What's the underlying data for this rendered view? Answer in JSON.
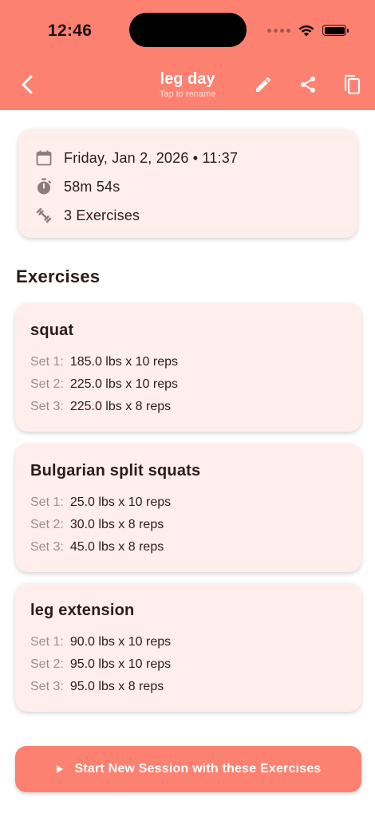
{
  "status": {
    "time": "12:46"
  },
  "header": {
    "title": "leg day",
    "subtitle": "Tap to rename",
    "icons": [
      "back-arrow-icon",
      "pencil-icon",
      "share-icon",
      "copy-icon"
    ]
  },
  "summary": {
    "date_time": "Friday, Jan 2, 2026 • 11:37",
    "duration": "58m 54s",
    "exercise_count": "3 Exercises",
    "icons": [
      "calendar-icon",
      "timer-icon",
      "dumbbell-icon"
    ]
  },
  "exercises_heading": "Exercises",
  "exercises": [
    {
      "name": "squat",
      "sets": [
        {
          "label": "Set 1:",
          "value": "185.0 lbs x 10 reps"
        },
        {
          "label": "Set 2:",
          "value": "225.0 lbs x 10 reps"
        },
        {
          "label": "Set 3:",
          "value": "225.0 lbs x 8 reps"
        }
      ]
    },
    {
      "name": "Bulgarian split squats",
      "sets": [
        {
          "label": "Set 1:",
          "value": "25.0 lbs x 10 reps"
        },
        {
          "label": "Set 2:",
          "value": "30.0 lbs x 8 reps"
        },
        {
          "label": "Set 3:",
          "value": "45.0 lbs x 8 reps"
        }
      ]
    },
    {
      "name": "leg extension",
      "sets": [
        {
          "label": "Set 1:",
          "value": "90.0 lbs x 10 reps"
        },
        {
          "label": "Set 2:",
          "value": "95.0 lbs x 10 reps"
        },
        {
          "label": "Set 3:",
          "value": "95.0 lbs x 8 reps"
        }
      ]
    }
  ],
  "cta": {
    "label": "Start New Session with these Exercises",
    "icon": "play-icon"
  },
  "colors": {
    "accent": "#fd8171",
    "card": "#ffeeec",
    "text": "#2a1c1a",
    "muted": "#9a8e8c"
  }
}
